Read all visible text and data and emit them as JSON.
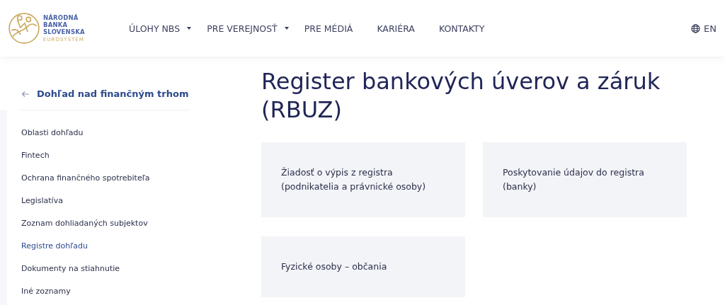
{
  "logo": {
    "lines": [
      "NÁRODNÁ",
      "BANKA",
      "SLOVENSKA"
    ],
    "subline": "EUROSYSTÉM"
  },
  "nav": [
    {
      "label": "ÚLOHY NBS",
      "has_menu": true
    },
    {
      "label": "PRE VEREJNOSŤ",
      "has_menu": true
    },
    {
      "label": "PRE MÉDIÁ",
      "has_menu": false
    },
    {
      "label": "KARIÉRA",
      "has_menu": false
    },
    {
      "label": "KONTAKTY",
      "has_menu": false
    }
  ],
  "language": "EN",
  "sidebar": {
    "back_link": "Dohľad nad finančným trhom",
    "items": [
      {
        "label": "Oblasti dohľadu",
        "selected": false
      },
      {
        "label": "Fintech",
        "selected": false
      },
      {
        "label": "Ochrana finančného spotrebiteľa",
        "selected": false
      },
      {
        "label": "Legislatíva",
        "selected": false
      },
      {
        "label": "Zoznam dohliadaných subjektov",
        "selected": false
      },
      {
        "label": "Registre dohľadu",
        "selected": true
      },
      {
        "label": "Dokumenty na stiahnutie",
        "selected": false
      },
      {
        "label": "Iné zoznamy",
        "selected": false
      }
    ]
  },
  "title": "Register bankových úverov a záruk (RBUZ)",
  "cards": [
    {
      "label": "Žiadosť o výpis z registra (podnikatelia a právnické osoby)"
    },
    {
      "label": "Poskytovanie údajov do registra (banky)"
    },
    {
      "label": "Fyzické osoby – občania"
    }
  ]
}
